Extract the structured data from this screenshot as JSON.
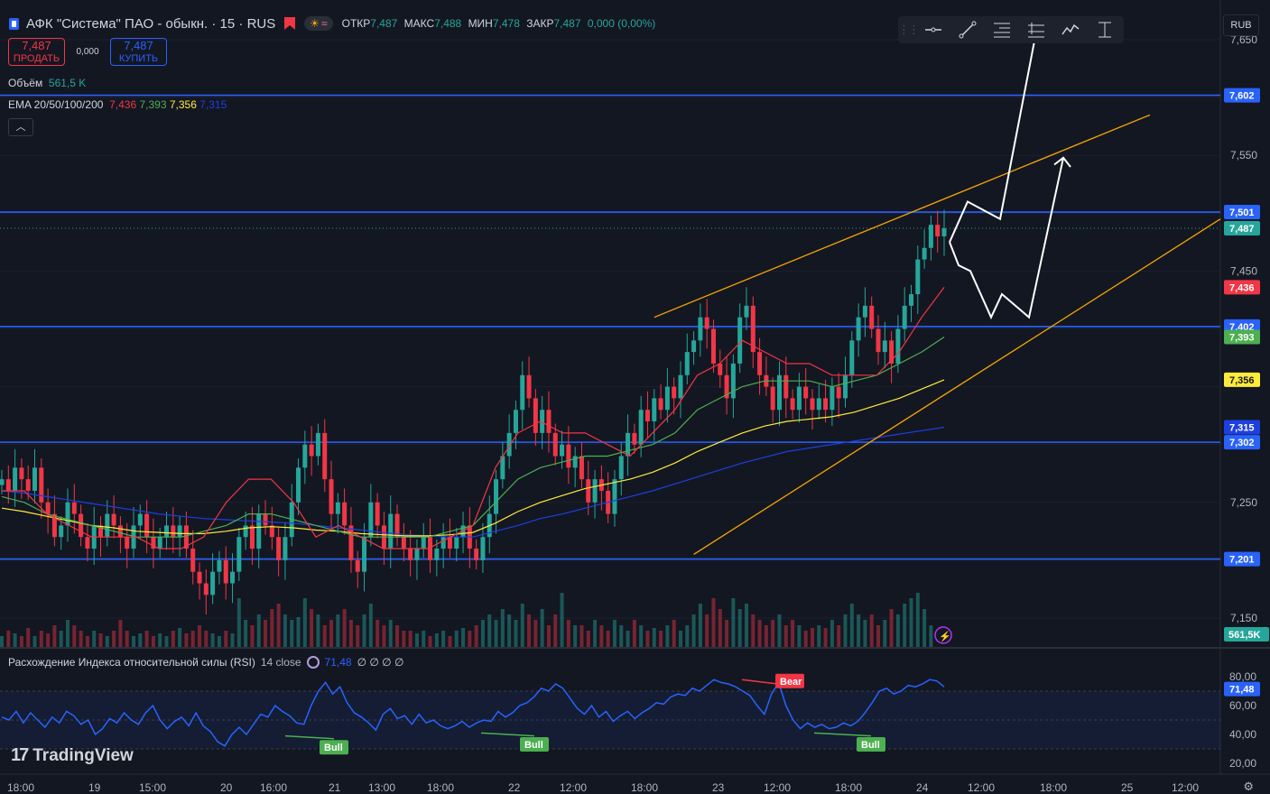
{
  "header": {
    "title": "АФК \"Система\" ПАО - обыкн. · 15 · RUS",
    "ohlc": [
      {
        "k": "ОТКР",
        "v": "7,487"
      },
      {
        "k": "МАКС",
        "v": "7,488"
      },
      {
        "k": "МИН",
        "v": "7,478"
      },
      {
        "k": "ЗАКР",
        "v": "7,487"
      }
    ],
    "change": "0,000 (0,00%)"
  },
  "trade": {
    "sell_price": "7,487",
    "sell_label": "ПРОДАТЬ",
    "spread": "0,000",
    "buy_price": "7,487",
    "buy_label": "КУПИТЬ"
  },
  "volume_label": {
    "name": "Объём",
    "value": "561,5 K"
  },
  "ema_label": {
    "name": "EMA 20/50/100/200",
    "v20": "7,436",
    "v50": "7,393",
    "v100": "7,356",
    "v200": "7,315"
  },
  "currency_button": "RUB",
  "rsi_label": {
    "name": "Расхождение Индекса относительной силы (RSI)",
    "params": "14 close",
    "value": "71,48",
    "extra": "∅ ∅ ∅ ∅"
  },
  "logo_text": "TradingView",
  "colors": {
    "bg": "#131722",
    "up": "#26a69a",
    "down": "#f23645",
    "level": "#2962ff",
    "channel": "#f7a600",
    "ema20": "#f23645",
    "ema50": "#4caf50",
    "ema100": "#ffeb3b",
    "ema200": "#2962ff",
    "rsi": "#2962ff"
  },
  "icons": [
    "horizontal-ray-icon",
    "trend-line-icon",
    "fib-retracement-icon",
    "long-position-icon",
    "path-icon",
    "measure-icon",
    "lightning-icon",
    "gear-icon"
  ],
  "chart_data": {
    "type": "candlestick",
    "price_ylim": [
      7.125,
      7.675
    ],
    "price_ticks": [
      "7,650",
      "7,550",
      "7,450",
      "7,250",
      "7,150"
    ],
    "horizontal_levels": [
      7.602,
      7.501,
      7.402,
      7.302,
      7.201
    ],
    "axis_badges": [
      {
        "text": "7,602",
        "price": 7.602,
        "color": "#2962ff"
      },
      {
        "text": "7,501",
        "price": 7.501,
        "color": "#2962ff"
      },
      {
        "text": "7,487",
        "price": 7.487,
        "color": "#26a69a"
      },
      {
        "text": "7,436",
        "price": 7.436,
        "color": "#f23645"
      },
      {
        "text": "7,402",
        "price": 7.402,
        "color": "#2962ff"
      },
      {
        "text": "7,393",
        "price": 7.393,
        "color": "#4caf50"
      },
      {
        "text": "7,356",
        "price": 7.356,
        "color": "#ffeb3b"
      },
      {
        "text": "7,315",
        "price": 7.315,
        "color": "#1e3fe0"
      },
      {
        "text": "7,302",
        "price": 7.302,
        "color": "#2962ff"
      },
      {
        "text": "7,201",
        "price": 7.201,
        "color": "#2962ff"
      }
    ],
    "volume_badge": "561,5K",
    "x_ticks": [
      "18:00",
      "19",
      "15:00",
      "20",
      "16:00",
      "21",
      "13:00",
      "18:00",
      "22",
      "12:00",
      "18:00",
      "23",
      "12:00",
      "18:00",
      "24",
      "12:00",
      "18:00",
      "25",
      "12:00"
    ],
    "close_series": [
      7.27,
      7.26,
      7.28,
      7.27,
      7.26,
      7.28,
      7.25,
      7.24,
      7.22,
      7.23,
      7.25,
      7.24,
      7.22,
      7.21,
      7.23,
      7.22,
      7.24,
      7.23,
      7.22,
      7.21,
      7.23,
      7.24,
      7.22,
      7.21,
      7.22,
      7.23,
      7.22,
      7.23,
      7.21,
      7.19,
      7.18,
      7.17,
      7.19,
      7.2,
      7.18,
      7.19,
      7.22,
      7.23,
      7.21,
      7.24,
      7.23,
      7.22,
      7.2,
      7.22,
      7.25,
      7.28,
      7.3,
      7.29,
      7.31,
      7.27,
      7.24,
      7.25,
      7.23,
      7.2,
      7.19,
      7.22,
      7.25,
      7.23,
      7.21,
      7.24,
      7.22,
      7.21,
      7.2,
      7.21,
      7.22,
      7.2,
      7.21,
      7.22,
      7.21,
      7.22,
      7.23,
      7.21,
      7.2,
      7.22,
      7.24,
      7.27,
      7.29,
      7.31,
      7.33,
      7.36,
      7.34,
      7.31,
      7.33,
      7.31,
      7.29,
      7.3,
      7.28,
      7.29,
      7.27,
      7.25,
      7.27,
      7.26,
      7.24,
      7.27,
      7.29,
      7.31,
      7.3,
      7.33,
      7.32,
      7.34,
      7.33,
      7.35,
      7.34,
      7.36,
      7.38,
      7.39,
      7.41,
      7.4,
      7.37,
      7.36,
      7.34,
      7.37,
      7.41,
      7.42,
      7.38,
      7.36,
      7.35,
      7.33,
      7.36,
      7.34,
      7.33,
      7.35,
      7.34,
      7.33,
      7.34,
      7.33,
      7.35,
      7.34,
      7.36,
      7.39,
      7.41,
      7.42,
      7.4,
      7.38,
      7.39,
      7.37,
      7.4,
      7.42,
      7.43,
      7.46,
      7.47,
      7.49,
      7.48,
      7.487
    ],
    "ema20": [
      7.26,
      7.26,
      7.24,
      7.23,
      7.22,
      7.22,
      7.22,
      7.21,
      7.21,
      7.22,
      7.25,
      7.27,
      7.27,
      7.25,
      7.22,
      7.23,
      7.22,
      7.21,
      7.21,
      7.21,
      7.22,
      7.23,
      7.28,
      7.31,
      7.32,
      7.31,
      7.31,
      7.3,
      7.29,
      7.31,
      7.33,
      7.36,
      7.37,
      7.39,
      7.38,
      7.37,
      7.37,
      7.36,
      7.36,
      7.36,
      7.38,
      7.41,
      7.436
    ],
    "ema50": [
      7.255,
      7.25,
      7.24,
      7.235,
      7.23,
      7.225,
      7.22,
      7.22,
      7.22,
      7.225,
      7.23,
      7.24,
      7.24,
      7.235,
      7.23,
      7.225,
      7.22,
      7.22,
      7.22,
      7.22,
      7.225,
      7.23,
      7.25,
      7.27,
      7.28,
      7.285,
      7.29,
      7.29,
      7.295,
      7.3,
      7.31,
      7.33,
      7.34,
      7.35,
      7.355,
      7.355,
      7.355,
      7.35,
      7.355,
      7.36,
      7.37,
      7.38,
      7.393
    ],
    "ema100": [
      7.245,
      7.242,
      7.238,
      7.234,
      7.23,
      7.228,
      7.225,
      7.224,
      7.223,
      7.223,
      7.225,
      7.228,
      7.229,
      7.228,
      7.226,
      7.225,
      7.223,
      7.222,
      7.221,
      7.221,
      7.222,
      7.224,
      7.232,
      7.242,
      7.25,
      7.256,
      7.262,
      7.266,
      7.27,
      7.276,
      7.284,
      7.294,
      7.302,
      7.31,
      7.316,
      7.32,
      7.322,
      7.324,
      7.328,
      7.334,
      7.34,
      7.348,
      7.356
    ],
    "ema200": [
      7.26,
      7.258,
      7.255,
      7.252,
      7.249,
      7.246,
      7.243,
      7.24,
      7.238,
      7.236,
      7.235,
      7.234,
      7.233,
      7.232,
      7.23,
      7.228,
      7.226,
      7.224,
      7.222,
      7.221,
      7.22,
      7.22,
      7.225,
      7.23,
      7.236,
      7.24,
      7.245,
      7.25,
      7.255,
      7.26,
      7.266,
      7.272,
      7.278,
      7.284,
      7.289,
      7.294,
      7.297,
      7.3,
      7.303,
      7.306,
      7.309,
      7.312,
      7.315
    ],
    "volume": [
      0.2,
      0.3,
      0.25,
      0.2,
      0.35,
      0.2,
      0.3,
      0.25,
      0.4,
      0.3,
      0.5,
      0.4,
      0.3,
      0.2,
      0.3,
      0.25,
      0.2,
      0.3,
      0.5,
      0.3,
      0.2,
      0.25,
      0.3,
      0.2,
      0.25,
      0.2,
      0.3,
      0.35,
      0.25,
      0.3,
      0.4,
      0.3,
      0.25,
      0.2,
      0.3,
      0.25,
      0.9,
      0.5,
      0.4,
      0.6,
      0.5,
      0.7,
      0.8,
      0.6,
      0.5,
      0.55,
      0.9,
      0.7,
      0.6,
      0.4,
      0.5,
      0.6,
      0.7,
      0.5,
      0.4,
      0.6,
      0.8,
      0.5,
      0.4,
      0.5,
      0.4,
      0.3,
      0.3,
      0.25,
      0.3,
      0.2,
      0.25,
      0.3,
      0.2,
      0.3,
      0.35,
      0.3,
      0.4,
      0.5,
      0.6,
      0.5,
      0.7,
      0.6,
      0.5,
      0.8,
      0.6,
      0.5,
      0.7,
      0.4,
      0.6,
      1.0,
      0.5,
      0.4,
      0.4,
      0.3,
      0.5,
      0.4,
      0.3,
      0.5,
      0.4,
      0.3,
      0.5,
      0.4,
      0.3,
      0.35,
      0.3,
      0.4,
      0.5,
      0.3,
      0.4,
      0.6,
      0.8,
      0.6,
      0.9,
      0.7,
      0.5,
      0.9,
      0.7,
      0.8,
      0.6,
      0.5,
      0.4,
      0.5,
      0.6,
      0.4,
      0.5,
      0.4,
      0.3,
      0.35,
      0.4,
      0.35,
      0.5,
      0.4,
      0.6,
      0.8,
      0.6,
      0.5,
      0.6,
      0.4,
      0.5,
      0.7,
      0.6,
      0.8,
      0.9,
      1.0,
      0.7,
      0.4
    ],
    "rsi": {
      "ylim": [
        20,
        85
      ],
      "ticks": [
        "80,00",
        "60,00",
        "40,00",
        "20,00"
      ],
      "bands": [
        70,
        30
      ],
      "value_badge": "71,48",
      "series": [
        52,
        50,
        56,
        48,
        55,
        50,
        45,
        52,
        48,
        56,
        53,
        47,
        50,
        40,
        44,
        51,
        48,
        55,
        50,
        47,
        55,
        60,
        50,
        44,
        49,
        52,
        46,
        55,
        46,
        42,
        35,
        32,
        40,
        45,
        40,
        47,
        54,
        52,
        60,
        56,
        53,
        48,
        47,
        60,
        70,
        76,
        68,
        73,
        62,
        55,
        52,
        48,
        43,
        54,
        58,
        51,
        53,
        47,
        54,
        48,
        50,
        46,
        44,
        46,
        49,
        45,
        48,
        50,
        49,
        56,
        52,
        55,
        60,
        62,
        66,
        72,
        70,
        75,
        72,
        65,
        58,
        54,
        60,
        52,
        56,
        49,
        53,
        56,
        51,
        55,
        58,
        62,
        61,
        66,
        68,
        67,
        72,
        70,
        74,
        78,
        76,
        75,
        73,
        70,
        67,
        60,
        54,
        68,
        76,
        60,
        50,
        44,
        48,
        45,
        47,
        44,
        45,
        48,
        46,
        49,
        55,
        62,
        70,
        72,
        68,
        70,
        74,
        73,
        75,
        78,
        77,
        73
      ],
      "labels": [
        {
          "text": "Bull",
          "color": "#4caf50"
        },
        {
          "text": "Bull",
          "color": "#4caf50"
        },
        {
          "text": "Bear",
          "color": "#f23645"
        },
        {
          "text": "Bull",
          "color": "#4caf50"
        }
      ]
    }
  }
}
